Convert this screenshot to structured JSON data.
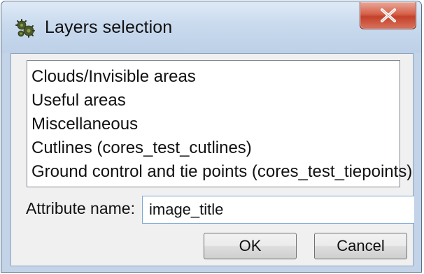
{
  "window": {
    "title": "Layers selection",
    "icon": "gear-cluster-icon",
    "close_icon": "close-icon"
  },
  "layers": {
    "items": [
      "Clouds/Invisible areas",
      "Useful areas",
      "Miscellaneous",
      "Cutlines (cores_test_cutlines)",
      "Ground control and tie points (cores_test_tiepoints)"
    ]
  },
  "attribute": {
    "label": "Attribute name:",
    "value": "image_title"
  },
  "buttons": {
    "ok": "OK",
    "cancel": "Cancel"
  },
  "colors": {
    "frame": "#c3d4e8",
    "close_button": "#c4412b",
    "client_background": "#f0f0f0",
    "input_focus_border": "#7aa7d8"
  }
}
